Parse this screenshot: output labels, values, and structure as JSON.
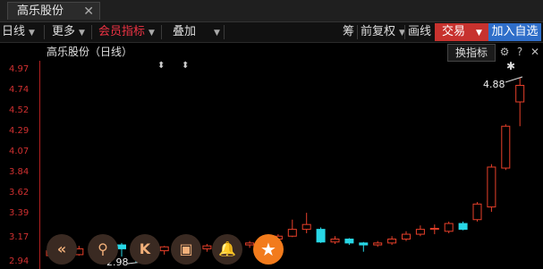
{
  "tab": {
    "title": "高乐股份",
    "close": "✕"
  },
  "toolbar": {
    "period": "日线",
    "more": "更多",
    "member": "会员指标",
    "overlay": "叠加",
    "chip": "筹",
    "adjust": "前复权",
    "drawline": "画线",
    "trade": "交易",
    "add": "加入自选"
  },
  "chart": {
    "title": "高乐股份（日线）",
    "change_indicator": "换指标",
    "yticks": [
      "4.97",
      "4.74",
      "4.52",
      "4.29",
      "4.07",
      "3.84",
      "3.62",
      "3.39",
      "3.17",
      "2.94"
    ],
    "high_label": "4.88",
    "low_label": "2.98",
    "colors": {
      "up": "#e8402a",
      "down": "#28d7e6",
      "axis": "#b02020"
    }
  },
  "bottom_tools": {
    "b1": "«",
    "b2": "⚲",
    "b3": "K",
    "b4": "▣",
    "b5": "🔔",
    "b6": "★"
  },
  "chart_data": {
    "type": "candlestick",
    "ylim": [
      2.94,
      4.97
    ],
    "candles": [
      {
        "o": 3.05,
        "c": 3.1,
        "h": 3.12,
        "l": 3.03
      },
      {
        "o": 3.1,
        "c": 3.06,
        "h": 3.12,
        "l": 3.02
      },
      {
        "o": 3.06,
        "c": 3.12,
        "h": 3.15,
        "l": 3.05
      },
      {
        "o": 3.12,
        "c": 3.1,
        "h": 3.16,
        "l": 3.08
      },
      {
        "o": 3.1,
        "c": 3.16,
        "h": 3.18,
        "l": 3.08
      },
      {
        "o": 3.16,
        "c": 3.12,
        "h": 3.18,
        "l": 3.04
      },
      {
        "o": 3.12,
        "c": 3.05,
        "h": 3.13,
        "l": 2.98
      },
      {
        "o": 3.05,
        "c": 3.1,
        "h": 3.12,
        "l": 3.02
      },
      {
        "o": 3.1,
        "c": 3.14,
        "h": 3.15,
        "l": 3.06
      },
      {
        "o": 3.14,
        "c": 3.08,
        "h": 3.15,
        "l": 3.06
      },
      {
        "o": 3.08,
        "c": 3.12,
        "h": 3.14,
        "l": 3.06
      },
      {
        "o": 3.12,
        "c": 3.15,
        "h": 3.17,
        "l": 3.09
      },
      {
        "o": 3.15,
        "c": 3.11,
        "h": 3.16,
        "l": 3.09
      },
      {
        "o": 3.11,
        "c": 3.16,
        "h": 3.18,
        "l": 3.1
      },
      {
        "o": 3.16,
        "c": 3.18,
        "h": 3.2,
        "l": 3.13
      },
      {
        "o": 3.18,
        "c": 3.22,
        "h": 3.24,
        "l": 3.16
      },
      {
        "o": 3.22,
        "c": 3.25,
        "h": 3.27,
        "l": 3.2
      },
      {
        "o": 3.25,
        "c": 3.32,
        "h": 3.42,
        "l": 3.24
      },
      {
        "o": 3.32,
        "c": 3.37,
        "h": 3.49,
        "l": 3.28
      },
      {
        "o": 3.32,
        "c": 3.19,
        "h": 3.34,
        "l": 3.18
      },
      {
        "o": 3.19,
        "c": 3.22,
        "h": 3.25,
        "l": 3.17
      },
      {
        "o": 3.22,
        "c": 3.18,
        "h": 3.23,
        "l": 3.16
      },
      {
        "o": 3.18,
        "c": 3.16,
        "h": 3.19,
        "l": 3.09
      },
      {
        "o": 3.16,
        "c": 3.18,
        "h": 3.2,
        "l": 3.14
      },
      {
        "o": 3.18,
        "c": 3.22,
        "h": 3.25,
        "l": 3.16
      },
      {
        "o": 3.22,
        "c": 3.27,
        "h": 3.3,
        "l": 3.2
      },
      {
        "o": 3.27,
        "c": 3.32,
        "h": 3.36,
        "l": 3.25
      },
      {
        "o": 3.32,
        "c": 3.33,
        "h": 3.37,
        "l": 3.27
      },
      {
        "o": 3.3,
        "c": 3.38,
        "h": 3.4,
        "l": 3.28
      },
      {
        "o": 3.38,
        "c": 3.32,
        "h": 3.4,
        "l": 3.31
      },
      {
        "o": 3.42,
        "c": 3.58,
        "h": 3.6,
        "l": 3.4
      },
      {
        "o": 3.55,
        "c": 3.96,
        "h": 3.99,
        "l": 3.5
      },
      {
        "o": 3.95,
        "c": 4.38,
        "h": 4.4,
        "l": 3.93
      },
      {
        "o": 4.63,
        "c": 4.8,
        "h": 4.88,
        "l": 4.38
      }
    ]
  }
}
